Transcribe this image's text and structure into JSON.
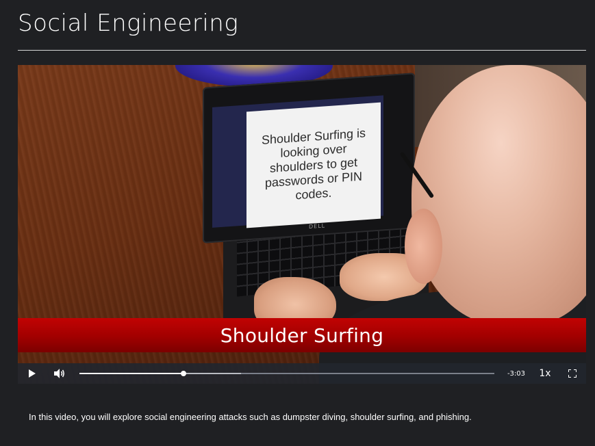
{
  "page": {
    "title": "Social Engineering",
    "description": "In this video, you will explore social engineering attacks such as dumpster diving, shoulder surfing, and phishing."
  },
  "video": {
    "slide_text": "Shoulder Surfing is looking over shoulders to get passwords or PIN codes.",
    "laptop_brand": "DELL",
    "caption": "Shoulder Surfing",
    "player": {
      "play_icon": "play-icon",
      "volume_icon": "volume-icon",
      "fullscreen_icon": "fullscreen-icon",
      "progress_fraction": 0.25,
      "buffered_fraction": 0.39,
      "time_remaining": "-3:03",
      "playback_speed": "1x"
    }
  },
  "colors": {
    "background": "#1f2023",
    "caption_bar": "#a10000",
    "controls_bar": "#22262e",
    "text": "#ffffff"
  }
}
